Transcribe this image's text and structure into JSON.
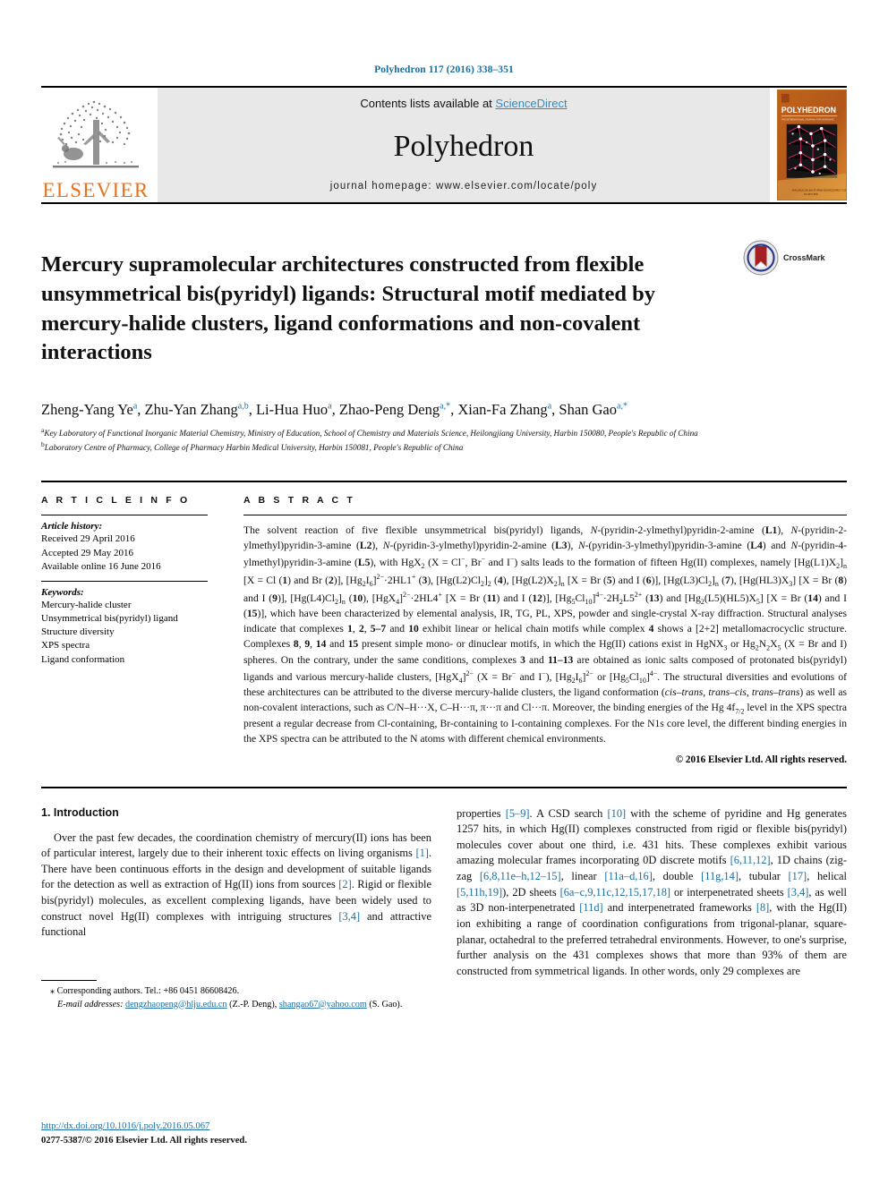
{
  "running_head": "Polyhedron 117 (2016) 338–351",
  "masthead": {
    "elsevier_wordmark": "ELSEVIER",
    "contents_prefix": "Contents lists available at ",
    "contents_link": "ScienceDirect",
    "journal_name": "Polyhedron",
    "homepage": "journal homepage: www.elsevier.com/locate/poly",
    "cover_title": "POLYHEDRON",
    "cover_subtitle": "THE INTERNATIONAL JOURNAL FOR INORGANIC AND ORGANOMETALLIC CHEMISTRY",
    "cover_footer": "ELSEVIER"
  },
  "article": {
    "title": "Mercury supramolecular architectures constructed from flexible unsymmetrical bis(pyridyl) ligands: Structural motif mediated by mercury-halide clusters, ligand conformations and non-covalent interactions",
    "crossmark_label": "CrossMark",
    "authors": [
      {
        "name": "Zheng-Yang Ye",
        "marks": "a"
      },
      {
        "name": "Zhu-Yan Zhang",
        "marks": "a,b"
      },
      {
        "name": "Li-Hua Huo",
        "marks": "a"
      },
      {
        "name": "Zhao-Peng Deng",
        "marks": "a,*"
      },
      {
        "name": "Xian-Fa Zhang",
        "marks": "a"
      },
      {
        "name": "Shan Gao",
        "marks": "a,*"
      }
    ],
    "affiliations": [
      {
        "mark": "a",
        "text": "Key Laboratory of Functional Inorganic Material Chemistry, Ministry of Education, School of Chemistry and Materials Science, Heilongjiang University, Harbin 150080, People's Republic of China"
      },
      {
        "mark": "b",
        "text": "Laboratory Centre of Pharmacy, College of Pharmacy Harbin Medical University, Harbin 150081, People's Republic of China"
      }
    ]
  },
  "article_info": {
    "heading": "A R T I C L E   I N F O",
    "history_label": "Article history:",
    "history": [
      "Received 29 April 2016",
      "Accepted 29 May 2016",
      "Available online 16 June 2016"
    ],
    "keywords_label": "Keywords:",
    "keywords": [
      "Mercury-halide cluster",
      "Unsymmetrical bis(pyridyl) ligand",
      "Structure diversity",
      "XPS spectra",
      "Ligand conformation"
    ]
  },
  "abstract": {
    "heading": "A B S T R A C T",
    "copyright": "© 2016 Elsevier Ltd. All rights reserved."
  },
  "introduction": {
    "heading": "1. Introduction"
  },
  "footnote": {
    "corresponding": "⁎ Corresponding authors. Tel.: +86 0451 86608426.",
    "email_label": "E-mail addresses:",
    "email1": "dengzhaopeng@hlju.edu.cn",
    "email1_owner": "(Z.-P. Deng),",
    "email2": "shangao67@yahoo.com",
    "email2_owner": "(S. Gao)."
  },
  "page_footer": {
    "doi": "http://dx.doi.org/10.1016/j.poly.2016.05.067",
    "issn": "0277-5387/© 2016 Elsevier Ltd. All rights reserved."
  },
  "colors": {
    "link": "#1a6ea0",
    "sciencedirect": "#2c8fc9",
    "elsevier_orange": "#E9711C",
    "band_grey": "#e8e8e8"
  }
}
